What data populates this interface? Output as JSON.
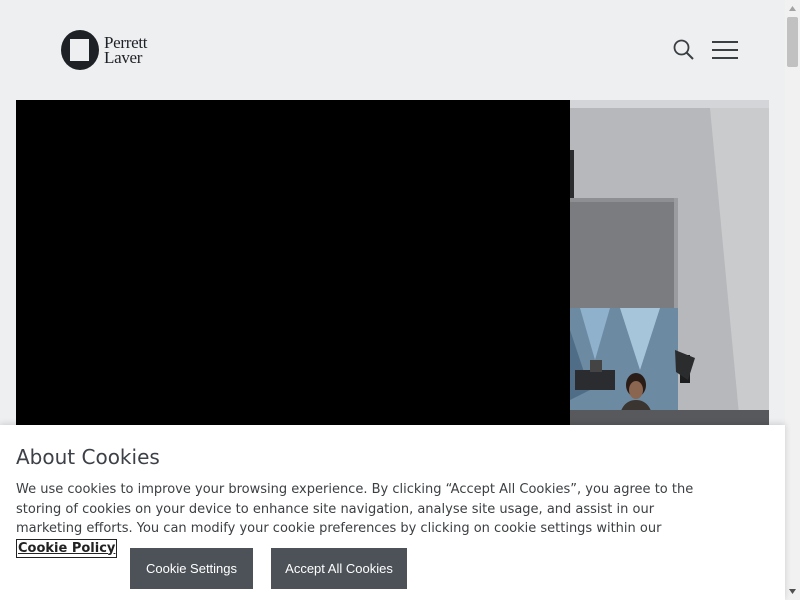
{
  "header": {
    "logo_text_line1": "Perrett",
    "logo_text_line2": "Laver",
    "search_icon": "search-icon",
    "menu_icon": "hamburger-menu-icon"
  },
  "hero": {
    "image": "video-still-woman-in-studio"
  },
  "cookies": {
    "title": "About Cookies",
    "body": "We use cookies to improve your browsing experience. By clicking “Accept All Cookies”, you agree to the storing of cookies on your device to enhance site navigation, analyse site usage, and assist in our marketing efforts. You can modify your cookie preferences by clicking on cookie settings within our",
    "policy_link": "Cookie Policy",
    "settings_button": "Cookie Settings",
    "accept_button": "Accept All Cookies",
    "button_color": "#4c5258"
  }
}
